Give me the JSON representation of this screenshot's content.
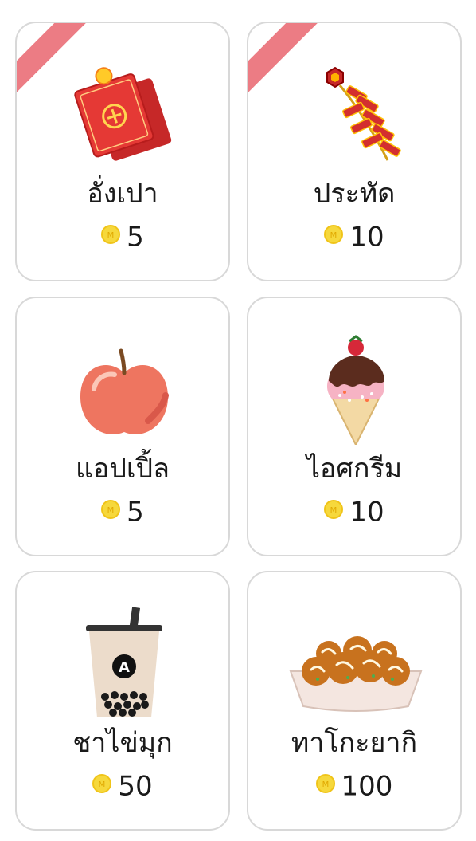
{
  "colors": {
    "ribbon": "#ec7c84",
    "border": "#d8d8d8",
    "coin": "#f6d83c",
    "text": "#1a1a1a"
  },
  "gifts": [
    {
      "name": "อั่งเปา",
      "price": "5",
      "ribbon": true,
      "icon": "red-envelope-icon"
    },
    {
      "name": "ประทัด",
      "price": "10",
      "ribbon": true,
      "icon": "firecracker-icon"
    },
    {
      "name": "แอปเปิ้ล",
      "price": "5",
      "ribbon": false,
      "icon": "apple-icon"
    },
    {
      "name": "ไอศกรีม",
      "price": "10",
      "ribbon": false,
      "icon": "ice-cream-icon"
    },
    {
      "name": "ชาไข่มุก",
      "price": "50",
      "ribbon": false,
      "icon": "bubble-tea-icon"
    },
    {
      "name": "ทาโกะยากิ",
      "price": "100",
      "ribbon": false,
      "icon": "takoyaki-icon"
    }
  ]
}
